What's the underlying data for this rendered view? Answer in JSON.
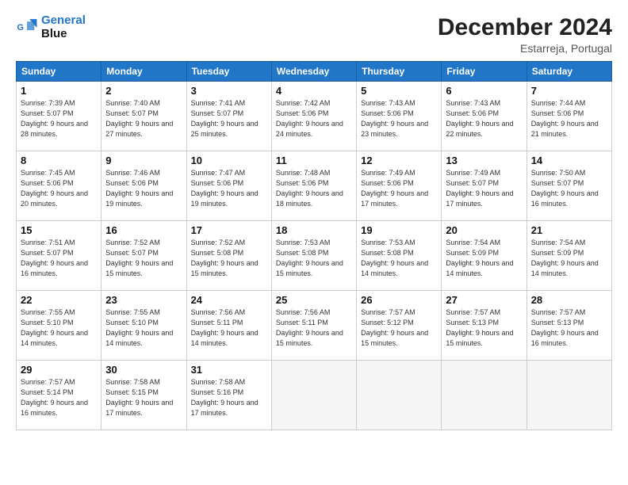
{
  "logo": {
    "line1": "General",
    "line2": "Blue"
  },
  "title": "December 2024",
  "subtitle": "Estarreja, Portugal",
  "weekdays": [
    "Sunday",
    "Monday",
    "Tuesday",
    "Wednesday",
    "Thursday",
    "Friday",
    "Saturday"
  ],
  "weeks": [
    [
      {
        "day": "1",
        "sr": "7:39 AM",
        "ss": "5:07 PM",
        "dl": "9 hours and 28 minutes."
      },
      {
        "day": "2",
        "sr": "7:40 AM",
        "ss": "5:07 PM",
        "dl": "9 hours and 27 minutes."
      },
      {
        "day": "3",
        "sr": "7:41 AM",
        "ss": "5:07 PM",
        "dl": "9 hours and 25 minutes."
      },
      {
        "day": "4",
        "sr": "7:42 AM",
        "ss": "5:06 PM",
        "dl": "9 hours and 24 minutes."
      },
      {
        "day": "5",
        "sr": "7:43 AM",
        "ss": "5:06 PM",
        "dl": "9 hours and 23 minutes."
      },
      {
        "day": "6",
        "sr": "7:43 AM",
        "ss": "5:06 PM",
        "dl": "9 hours and 22 minutes."
      },
      {
        "day": "7",
        "sr": "7:44 AM",
        "ss": "5:06 PM",
        "dl": "9 hours and 21 minutes."
      }
    ],
    [
      {
        "day": "8",
        "sr": "7:45 AM",
        "ss": "5:06 PM",
        "dl": "9 hours and 20 minutes."
      },
      {
        "day": "9",
        "sr": "7:46 AM",
        "ss": "5:06 PM",
        "dl": "9 hours and 19 minutes."
      },
      {
        "day": "10",
        "sr": "7:47 AM",
        "ss": "5:06 PM",
        "dl": "9 hours and 19 minutes."
      },
      {
        "day": "11",
        "sr": "7:48 AM",
        "ss": "5:06 PM",
        "dl": "9 hours and 18 minutes."
      },
      {
        "day": "12",
        "sr": "7:49 AM",
        "ss": "5:06 PM",
        "dl": "9 hours and 17 minutes."
      },
      {
        "day": "13",
        "sr": "7:49 AM",
        "ss": "5:07 PM",
        "dl": "9 hours and 17 minutes."
      },
      {
        "day": "14",
        "sr": "7:50 AM",
        "ss": "5:07 PM",
        "dl": "9 hours and 16 minutes."
      }
    ],
    [
      {
        "day": "15",
        "sr": "7:51 AM",
        "ss": "5:07 PM",
        "dl": "9 hours and 16 minutes."
      },
      {
        "day": "16",
        "sr": "7:52 AM",
        "ss": "5:07 PM",
        "dl": "9 hours and 15 minutes."
      },
      {
        "day": "17",
        "sr": "7:52 AM",
        "ss": "5:08 PM",
        "dl": "9 hours and 15 minutes."
      },
      {
        "day": "18",
        "sr": "7:53 AM",
        "ss": "5:08 PM",
        "dl": "9 hours and 15 minutes."
      },
      {
        "day": "19",
        "sr": "7:53 AM",
        "ss": "5:08 PM",
        "dl": "9 hours and 14 minutes."
      },
      {
        "day": "20",
        "sr": "7:54 AM",
        "ss": "5:09 PM",
        "dl": "9 hours and 14 minutes."
      },
      {
        "day": "21",
        "sr": "7:54 AM",
        "ss": "5:09 PM",
        "dl": "9 hours and 14 minutes."
      }
    ],
    [
      {
        "day": "22",
        "sr": "7:55 AM",
        "ss": "5:10 PM",
        "dl": "9 hours and 14 minutes."
      },
      {
        "day": "23",
        "sr": "7:55 AM",
        "ss": "5:10 PM",
        "dl": "9 hours and 14 minutes."
      },
      {
        "day": "24",
        "sr": "7:56 AM",
        "ss": "5:11 PM",
        "dl": "9 hours and 14 minutes."
      },
      {
        "day": "25",
        "sr": "7:56 AM",
        "ss": "5:11 PM",
        "dl": "9 hours and 15 minutes."
      },
      {
        "day": "26",
        "sr": "7:57 AM",
        "ss": "5:12 PM",
        "dl": "9 hours and 15 minutes."
      },
      {
        "day": "27",
        "sr": "7:57 AM",
        "ss": "5:13 PM",
        "dl": "9 hours and 15 minutes."
      },
      {
        "day": "28",
        "sr": "7:57 AM",
        "ss": "5:13 PM",
        "dl": "9 hours and 16 minutes."
      }
    ],
    [
      {
        "day": "29",
        "sr": "7:57 AM",
        "ss": "5:14 PM",
        "dl": "9 hours and 16 minutes."
      },
      {
        "day": "30",
        "sr": "7:58 AM",
        "ss": "5:15 PM",
        "dl": "9 hours and 17 minutes."
      },
      {
        "day": "31",
        "sr": "7:58 AM",
        "ss": "5:16 PM",
        "dl": "9 hours and 17 minutes."
      },
      null,
      null,
      null,
      null
    ]
  ]
}
